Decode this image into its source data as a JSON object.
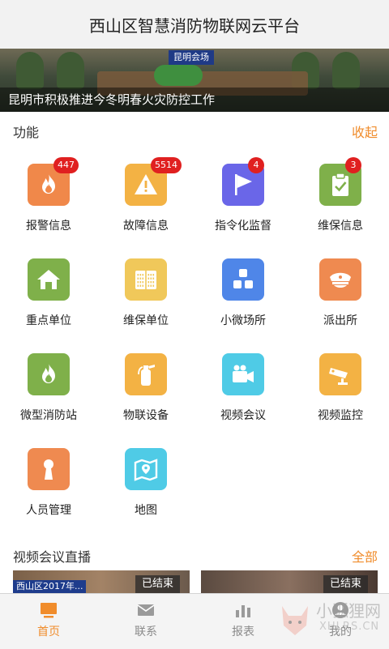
{
  "header": {
    "title": "西山区智慧消防物联网云平台"
  },
  "banner": {
    "sign": "昆明会场",
    "caption": "昆明市积极推进今冬明春火灾防控工作"
  },
  "functions": {
    "title": "功能",
    "collapse_label": "收起",
    "items": [
      {
        "label": "报警信息",
        "icon": "fire-icon",
        "color": "#f0884a",
        "badge": "447"
      },
      {
        "label": "故障信息",
        "icon": "warning-triangle-icon",
        "color": "#f3b244",
        "badge": "5514"
      },
      {
        "label": "指令化监督",
        "icon": "flag-icon",
        "color": "#6a66e8",
        "badge": "4"
      },
      {
        "label": "维保信息",
        "icon": "clipboard-check-icon",
        "color": "#7fb04a",
        "badge": "3"
      },
      {
        "label": "重点单位",
        "icon": "home-icon",
        "color": "#7fb04a"
      },
      {
        "label": "维保单位",
        "icon": "building-icon",
        "color": "#f0c85a"
      },
      {
        "label": "小微场所",
        "icon": "blocks-icon",
        "color": "#4f86e8"
      },
      {
        "label": "派出所",
        "icon": "police-cap-icon",
        "color": "#ef8a50"
      },
      {
        "label": "微型消防站",
        "icon": "fire-icon",
        "color": "#7fb04a"
      },
      {
        "label": "物联设备",
        "icon": "extinguisher-icon",
        "color": "#f3b244"
      },
      {
        "label": "视频会议",
        "icon": "video-camera-icon",
        "color": "#4fcbe6"
      },
      {
        "label": "视频监控",
        "icon": "cctv-camera-icon",
        "color": "#f3b244"
      },
      {
        "label": "人员管理",
        "icon": "person-icon",
        "color": "#ef8a50"
      },
      {
        "label": "地图",
        "icon": "map-icon",
        "color": "#4fcbe6"
      }
    ]
  },
  "video_live": {
    "title": "视频会议直播",
    "all_label": "全部",
    "cards": [
      {
        "status": "已结束",
        "banner_text": "西山区2017年..."
      },
      {
        "status": "已结束"
      }
    ]
  },
  "tabbar": {
    "tabs": [
      {
        "label": "首页",
        "icon": "monitor-icon",
        "active": true
      },
      {
        "label": "联系",
        "icon": "envelope-icon",
        "active": false
      },
      {
        "label": "报表",
        "icon": "bar-chart-icon",
        "active": false
      },
      {
        "label": "我的",
        "icon": "user-icon",
        "active": false
      }
    ]
  },
  "watermark": {
    "line1": "小狐狸网",
    "line2": "XHLRS.CN"
  },
  "colors": {
    "accent": "#f08c2b",
    "badge": "#e02020"
  }
}
